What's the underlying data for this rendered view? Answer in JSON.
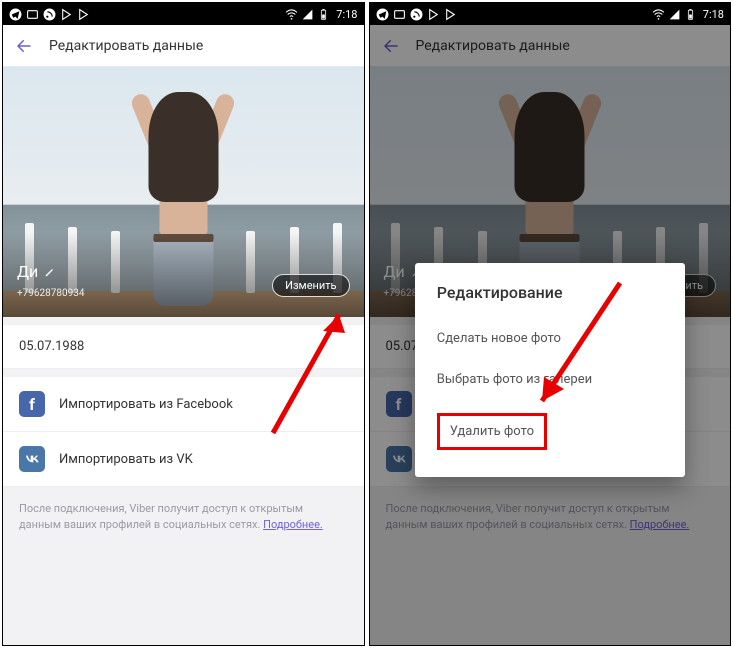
{
  "status": {
    "time": "7:18"
  },
  "header": {
    "title": "Редактировать данные"
  },
  "profile": {
    "name": "Ди",
    "phone": "+79628780934",
    "edit_button": "Изменить"
  },
  "birthday": "05.07.1988",
  "imports": {
    "facebook": "Импортировать из Facebook",
    "vk": "Импортировать из VK"
  },
  "footer": {
    "text": "После подключения, Viber получит доступ к открытым данным ваших профилей в социальных сетях.",
    "more": "Подробнее."
  },
  "dialog": {
    "title": "Редактирование",
    "option_take": "Сделать новое фото",
    "option_gallery": "Выбрать фото из галереи",
    "option_delete": "Удалить фото"
  }
}
